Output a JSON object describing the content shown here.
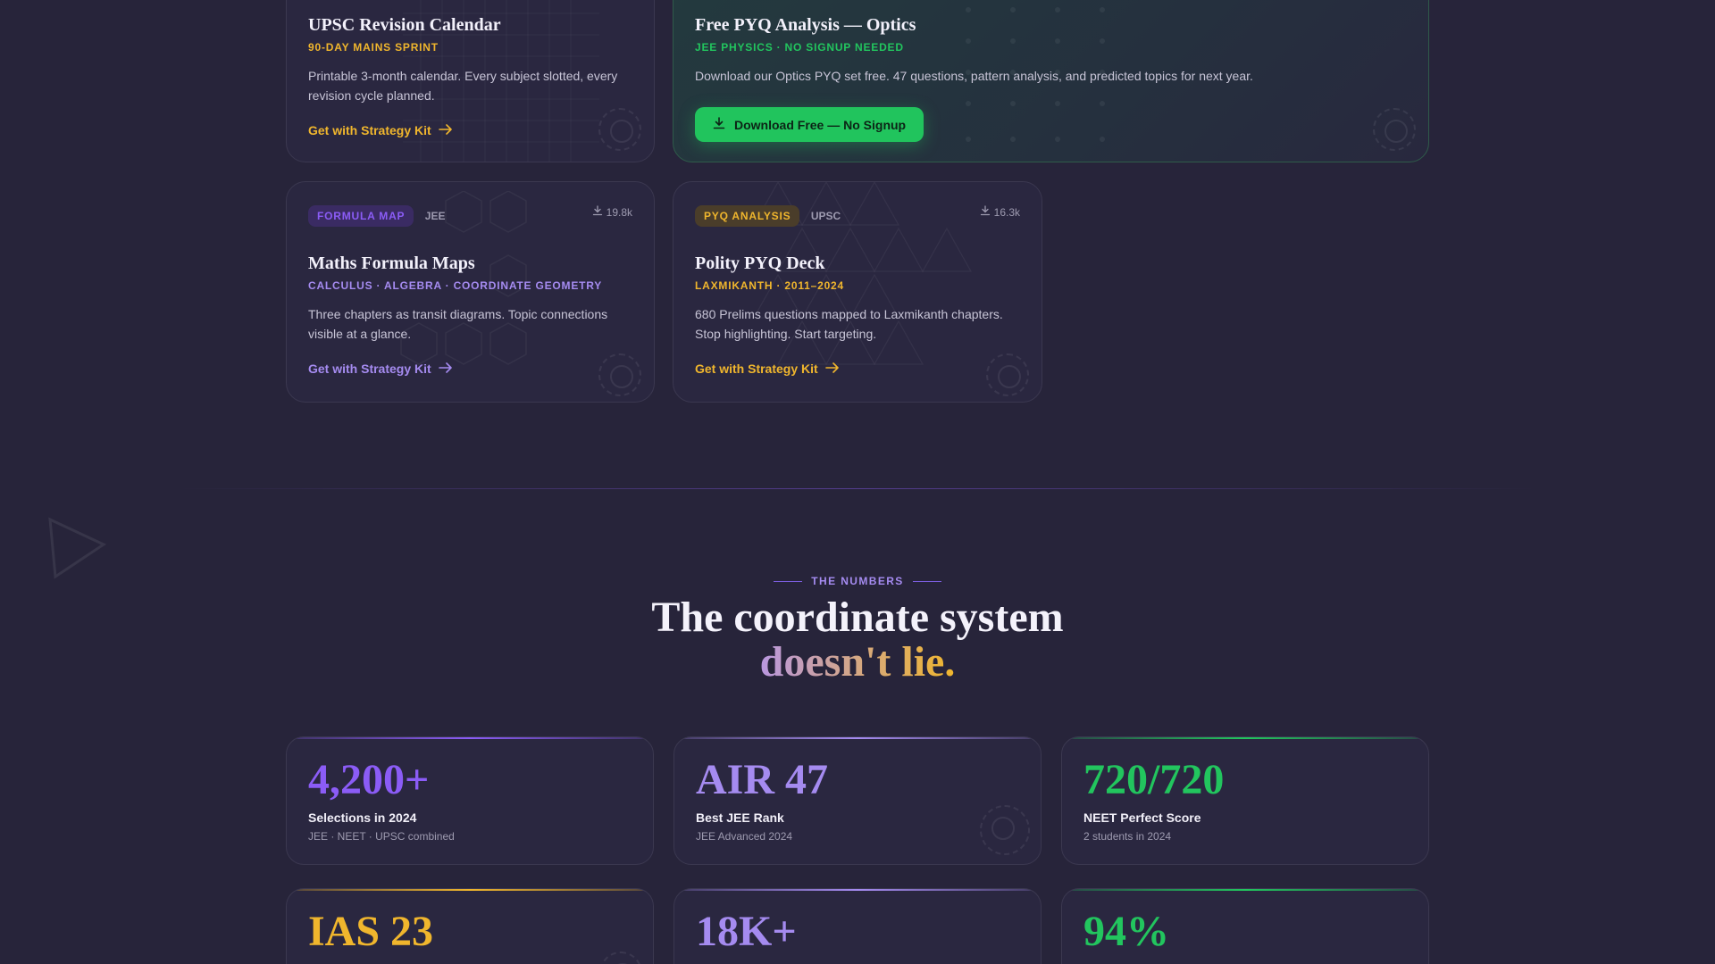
{
  "cards": {
    "upsc_calendar": {
      "title": "UPSC Revision Calendar",
      "subtitle": "90-DAY MAINS SPRINT",
      "description": "Printable 3-month calendar. Every subject slotted, every revision cycle planned.",
      "link": "Get with Strategy Kit",
      "accent": "#f0b62d"
    },
    "optics": {
      "title": "Free PYQ Analysis — Optics",
      "subtitle": "JEE PHYSICS · NO SIGNUP NEEDED",
      "description": "Download our Optics PYQ set free. 47 questions, pattern analysis, and predicted topics for next year.",
      "button": "Download Free — No Signup",
      "accent": "#21c45d"
    },
    "maths": {
      "tag": "FORMULA MAP",
      "tag2": "JEE",
      "downloads": "19.8k",
      "title": "Maths Formula Maps",
      "subtitle": "CALCULUS · ALGEBRA · COORDINATE GEOMETRY",
      "description": "Three chapters as transit diagrams. Topic connections visible at a glance.",
      "link": "Get with Strategy Kit",
      "accent": "#8b5cf6"
    },
    "polity": {
      "tag": "PYQ ANALYSIS",
      "tag2": "UPSC",
      "downloads": "16.3k",
      "title": "Polity PYQ Deck",
      "subtitle": "LAXMIKANTH · 2011–2024",
      "description": "680 Prelims questions mapped to Laxmikanth chapters. Stop highlighting. Start targeting.",
      "link": "Get with Strategy Kit",
      "accent": "#f0b62d"
    }
  },
  "numbers": {
    "eyebrow": "THE NUMBERS",
    "headline_line1": "The coordinate system",
    "headline_line2": "doesn't lie."
  },
  "stats": [
    {
      "value": "4,200+",
      "label": "Selections in 2024",
      "note": "JEE · NEET · UPSC combined",
      "color": "#8b5cf6"
    },
    {
      "value": "AIR 47",
      "label": "Best JEE Rank",
      "note": "JEE Advanced 2024",
      "color": "#a58bf0"
    },
    {
      "value": "720/720",
      "label": "NEET Perfect Score",
      "note": "2 students in 2024",
      "color": "#22c55e"
    },
    {
      "value": "IAS 23",
      "label": "",
      "note": "",
      "color": "#f0b62d"
    },
    {
      "value": "18K+",
      "label": "",
      "note": "",
      "color": "#a58bf0"
    },
    {
      "value": "94%",
      "label": "",
      "note": "",
      "color": "#22c55e"
    }
  ]
}
